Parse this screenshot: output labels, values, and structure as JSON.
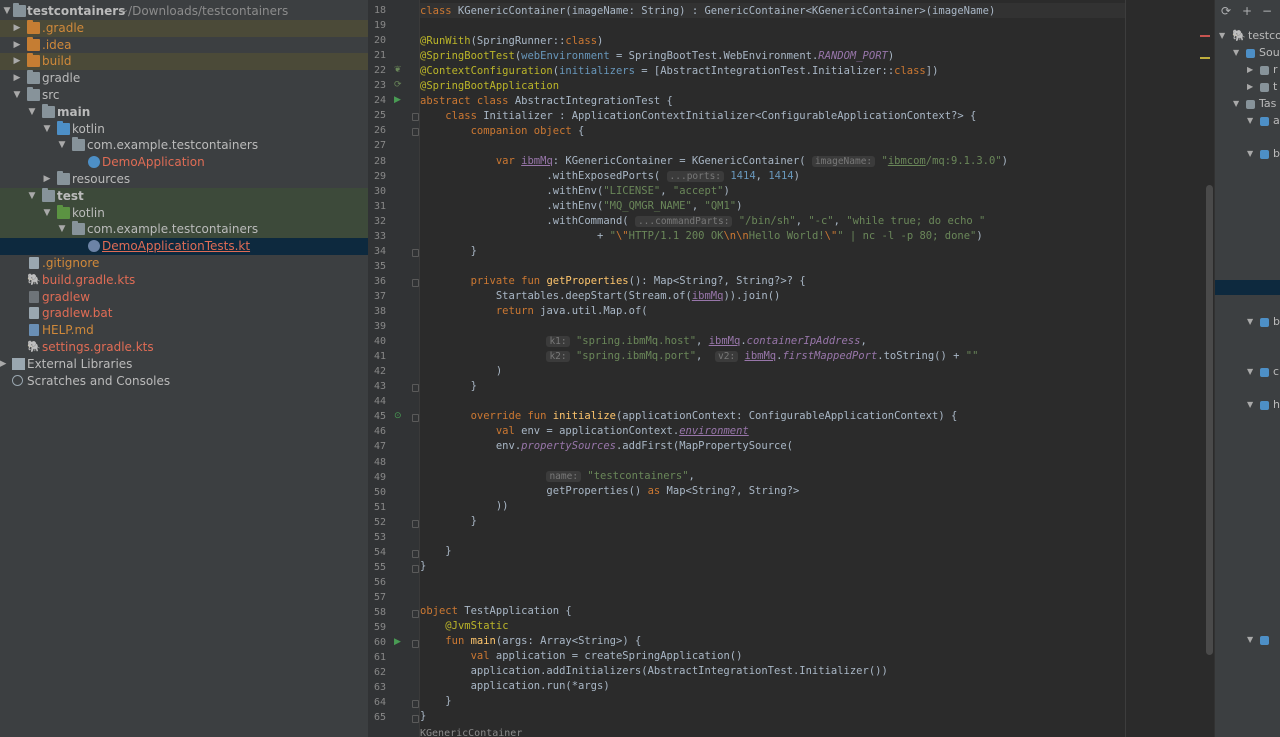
{
  "project": {
    "root_name": "testcontainers",
    "root_path": "~/Downloads/testcontainers",
    "items": [
      {
        "label": ".gradle",
        "icon": "folder-icon",
        "color": "orange"
      },
      {
        "label": ".idea",
        "icon": "folder-icon",
        "color": "orange"
      },
      {
        "label": "build",
        "icon": "folder-icon",
        "color": "orange"
      },
      {
        "label": "gradle",
        "icon": "folder-icon",
        "color": "white"
      },
      {
        "label": "src",
        "icon": "folder-icon",
        "color": "white"
      },
      {
        "label": "main",
        "icon": "folder-icon"
      },
      {
        "label": "kotlin",
        "icon": "source-folder-icon"
      },
      {
        "label": "com.example.testcontainers",
        "icon": "package-icon"
      },
      {
        "label": "DemoApplication",
        "icon": "kotlin-class-icon"
      },
      {
        "label": "resources",
        "icon": "resources-folder-icon"
      },
      {
        "label": "test",
        "icon": "test-folder-icon"
      },
      {
        "label": "kotlin",
        "icon": "test-source-folder-icon"
      },
      {
        "label": "com.example.testcontainers",
        "icon": "package-icon"
      },
      {
        "label": "DemoApplicationTests.kt",
        "icon": "kotlin-file-icon"
      },
      {
        "label": ".gitignore",
        "icon": "text-file-icon"
      },
      {
        "label": "build.gradle.kts",
        "icon": "gradle-icon"
      },
      {
        "label": "gradlew",
        "icon": "terminal-file-icon"
      },
      {
        "label": "gradlew.bat",
        "icon": "bat-file-icon"
      },
      {
        "label": "HELP.md",
        "icon": "markdown-file-icon"
      },
      {
        "label": "settings.gradle.kts",
        "icon": "gradle-icon"
      },
      {
        "label": "External Libraries",
        "icon": "library-icon"
      },
      {
        "label": "Scratches and Consoles",
        "icon": "scratch-icon"
      }
    ]
  },
  "editor": {
    "line_numbers": [
      "18",
      "19",
      "20",
      "21",
      "22",
      "23",
      "24",
      "25",
      "26",
      "27",
      "28",
      "29",
      "30",
      "31",
      "32",
      "33",
      "34",
      "35",
      "36",
      "37",
      "38",
      "39",
      "40",
      "41",
      "42",
      "43",
      "44",
      "45",
      "46",
      "47",
      "48",
      "49",
      "50",
      "51",
      "52",
      "53",
      "54",
      "55",
      "56",
      "57",
      "58",
      "59",
      "60",
      "61",
      "62",
      "63",
      "64",
      "65"
    ],
    "bottom_fragment": "KGenericContainer"
  },
  "gradle_panel": {
    "rows": [
      "testco",
      "Sou",
      "r",
      "t",
      "Tas",
      "a",
      "b",
      "b",
      "c",
      "h"
    ]
  }
}
